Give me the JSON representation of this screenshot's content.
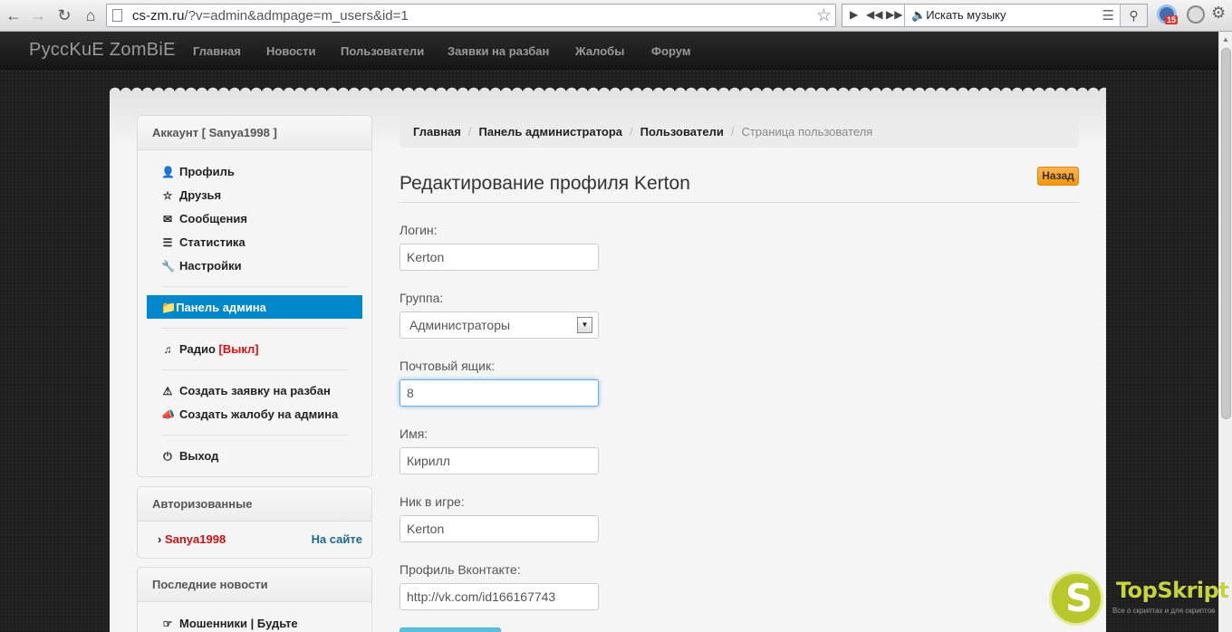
{
  "browser": {
    "url": "cs-zm.ru/?v=admin&admpage=m_users&id=1",
    "url_host": "cs-zm.ru",
    "url_path": "/?v=admin&admpage=m_users&id=1",
    "music_search_label": "Искать музыку",
    "extension_badge": "15"
  },
  "navbar": {
    "brand": "PусcKuE ZomBiE",
    "links": [
      "Главная",
      "Новости",
      "Пользователи",
      "Заявки на разбан",
      "Жалобы",
      "Форум"
    ]
  },
  "sidebar": {
    "account_title": "Аккаунт [ Sanya1998 ]",
    "items": [
      {
        "label": "Профиль",
        "icon": "user-icon"
      },
      {
        "label": "Друзья",
        "icon": "star-icon"
      },
      {
        "label": "Сообщения",
        "icon": "envelope-icon"
      },
      {
        "label": "Статистика",
        "icon": "list-icon"
      },
      {
        "label": "Настройки",
        "icon": "wrench-icon"
      }
    ],
    "admin_panel": {
      "label": "Панель админа",
      "icon": "folder-open-icon"
    },
    "radio": {
      "label": "Радио",
      "status": "[Выкл]",
      "icon": "music-icon"
    },
    "actions": [
      {
        "label": "Создать заявку на разбан",
        "icon": "warning-icon"
      },
      {
        "label": "Создать жалобу на админа",
        "icon": "bullhorn-icon"
      }
    ],
    "logout": {
      "label": "Выход",
      "icon": "power-icon"
    },
    "authorized_title": "Авторизованные",
    "online_users": [
      {
        "name": "Sanya1998",
        "status": "На сайте"
      }
    ],
    "news_title": "Последние новости",
    "news_items": [
      {
        "label": "Мошенники | Будьте"
      }
    ]
  },
  "breadcrumb": {
    "items": [
      "Главная",
      "Панель администратора",
      "Пользователи"
    ],
    "active": "Страница пользователя"
  },
  "page": {
    "title": "Редактирование профиля Kerton",
    "back_button": "Назад"
  },
  "form": {
    "login_label": "Логин:",
    "login_value": "Kerton",
    "group_label": "Группа:",
    "group_value": "Администраторы",
    "email_label": "Почтовый ящик:",
    "email_value": "8",
    "name_label": "Имя:",
    "name_value": "Кирилл",
    "nick_label": "Ник в игре:",
    "nick_value": "Kerton",
    "vk_label": "Профиль Вконтакте:",
    "vk_value": "http://vk.com/id166167743"
  },
  "watermark": {
    "letter": "S",
    "name": "TopSkript",
    "tagline": "Все о скриптах и для скриптов"
  },
  "colors": {
    "active_menu": "#0088cc",
    "back_button": "#f89406",
    "online_user": "#cc1111",
    "radio_off": "#dd1111"
  }
}
